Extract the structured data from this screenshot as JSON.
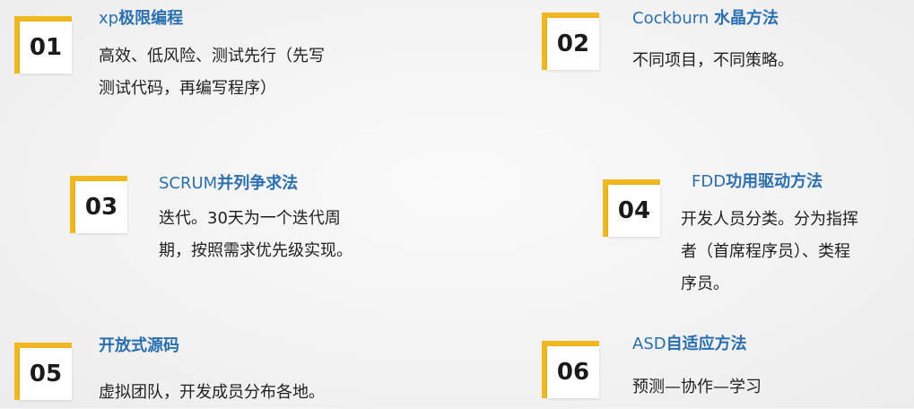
{
  "items": [
    {
      "num": "01",
      "title_latin": "xp",
      "title_cjk": "极限编程",
      "desc_lines": [
        "高效、低风险、测试先行（先写",
        "测试代码，再编写程序）"
      ]
    },
    {
      "num": "02",
      "title_latin": "Cockburn ",
      "title_cjk": "水晶方法",
      "desc_lines": [
        "不同项目，不同策略。"
      ]
    },
    {
      "num": "03",
      "title_latin": "SCRUM",
      "title_cjk": "并列争求法",
      "desc_lines": [
        "迭代。30天为一个迭代周",
        "期，按照需求优先级实现。"
      ]
    },
    {
      "num": "04",
      "title_latin": "FDD",
      "title_cjk": "功用驱动方法",
      "desc_lines": [
        "开发人员分类。分为指挥",
        "者（首席程序员）、类程",
        "序员。"
      ]
    },
    {
      "num": "05",
      "title_latin": "",
      "title_cjk": "开放式源码",
      "desc_lines": [
        "虚拟团队，开发成员分布各地。"
      ]
    },
    {
      "num": "06",
      "title_latin": "ASD",
      "title_cjk": "自适应方法",
      "desc_lines": [
        "预测—协作—学习"
      ]
    }
  ],
  "colors": {
    "accent": "#f2b820",
    "title": "#2a6fb2",
    "text": "#1f1f1f"
  }
}
